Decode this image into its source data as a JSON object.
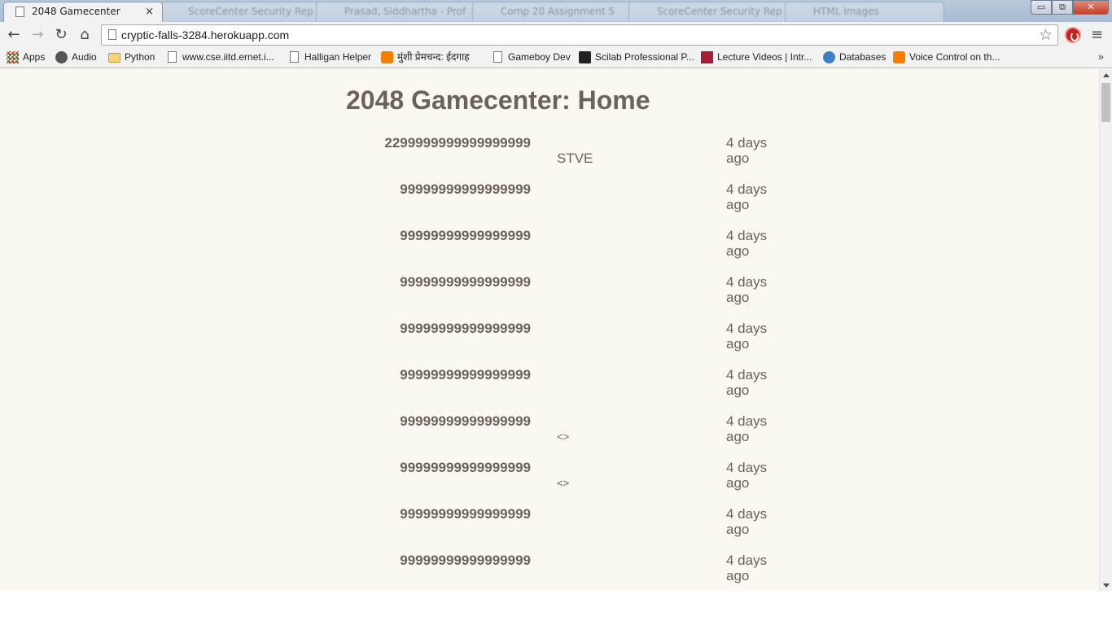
{
  "browser": {
    "active_tab": {
      "title": "2048 Gamecenter",
      "close": "×"
    },
    "background_tabs": [
      {
        "title": "ScoreCenter Security Rep",
        "close": "×"
      },
      {
        "title": "Prasad, Siddhartha - Prof",
        "close": "×"
      },
      {
        "title": "Comp 20 Assignment 5",
        "close": "×"
      },
      {
        "title": "ScoreCenter Security Rep",
        "close": "×"
      },
      {
        "title": "HTML Images",
        "close": "×"
      }
    ],
    "window_controls": {
      "minimize": "▭",
      "restore": "⧉",
      "close": "✕"
    },
    "nav": {
      "back": "←",
      "forward": "→",
      "reload": "↻",
      "home": "⌂"
    },
    "url": "cryptic-falls-3284.herokuapp.com",
    "star": "☆",
    "menu": "≡"
  },
  "bookmarks": [
    {
      "label": "Apps",
      "icon": "apps-grid-icon"
    },
    {
      "label": "Audio",
      "icon": "audio-icon"
    },
    {
      "label": "Python",
      "icon": "folder-icon"
    },
    {
      "label": "www.cse.iitd.ernet.i...",
      "icon": "page-icon"
    },
    {
      "label": "Halligan Helper",
      "icon": "page-icon"
    },
    {
      "label": "मुंशी प्रेमचन्द: ईदगाह",
      "icon": "blogger-icon"
    },
    {
      "label": "Gameboy Dev",
      "icon": "page-icon"
    },
    {
      "label": "Scilab Professional P...",
      "icon": "scilab-icon"
    },
    {
      "label": "Lecture Videos | Intr...",
      "icon": "mit-ocw-icon"
    },
    {
      "label": "Databases",
      "icon": "databases-icon"
    },
    {
      "label": "Voice Control on th...",
      "icon": "blogger-icon"
    }
  ],
  "bookmarks_more": "»",
  "page": {
    "title": "2048 Gamecenter: Home",
    "scores": [
      {
        "score": "2299999999999999999",
        "user": "STVE",
        "time": "4 days ago"
      },
      {
        "score": "99999999999999999",
        "user": "",
        "time": "4 days ago"
      },
      {
        "score": "99999999999999999",
        "user": "",
        "time": "4 days ago"
      },
      {
        "score": "99999999999999999",
        "user": "",
        "time": "4 days ago"
      },
      {
        "score": "99999999999999999",
        "user": "",
        "time": "4 days ago"
      },
      {
        "score": "99999999999999999",
        "user": "",
        "time": "4 days ago"
      },
      {
        "score": "99999999999999999",
        "user": "<>",
        "time": "4 days ago"
      },
      {
        "score": "99999999999999999",
        "user": "<>",
        "time": "4 days ago"
      },
      {
        "score": "99999999999999999",
        "user": "",
        "time": "4 days ago"
      },
      {
        "score": "99999999999999999",
        "user": "",
        "time": "4 days ago"
      }
    ]
  }
}
